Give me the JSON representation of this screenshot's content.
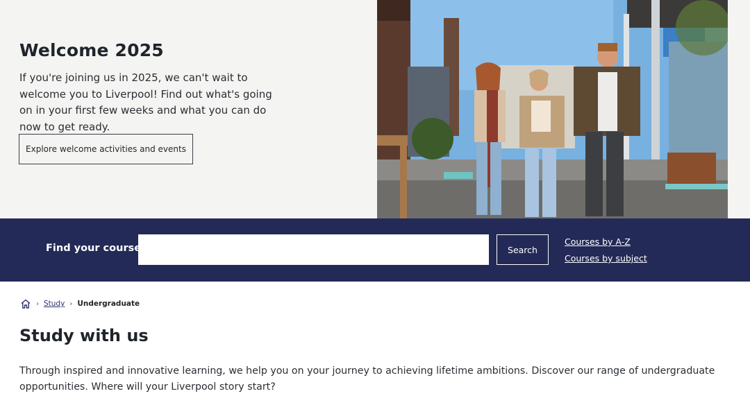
{
  "hero": {
    "title": "Welcome 2025",
    "body": "If you're joining us in 2025, we can't wait to welcome you to Liverpool! Find out what's going on in your first few weeks and what you can do now to get ready.",
    "cta_label": "Explore welcome activities and events"
  },
  "search": {
    "label": "Find your course",
    "input_value": "",
    "button_label": "Search",
    "links": [
      "Courses by A-Z",
      "Courses by subject"
    ]
  },
  "breadcrumb": {
    "items": [
      "Study"
    ],
    "current": "Undergraduate"
  },
  "main": {
    "title": "Study with us",
    "body": "Through inspired and innovative learning, we help you on your journey to achieving lifetime ambitions. Discover our range of undergraduate opportunities. Where will your Liverpool story start?"
  },
  "colors": {
    "search_band": "#232a57",
    "hero_background": "#f4f4f2",
    "link": "#2b3170"
  },
  "icons": {
    "breadcrumb_home": "home-icon",
    "breadcrumb_separator": "chevron-right-icon"
  }
}
